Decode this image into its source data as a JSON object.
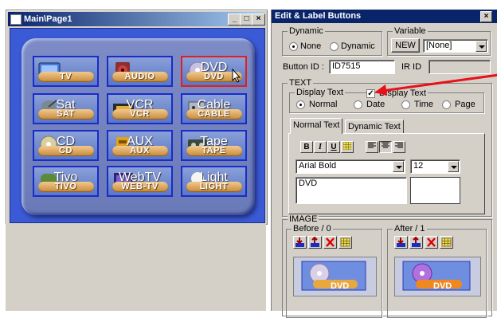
{
  "main_window": {
    "title": "Main\\Page1",
    "controls": {
      "minimize": "_",
      "maximize": "□",
      "close": "×"
    },
    "buttons": [
      {
        "label": "TV",
        "big": "",
        "icon": "tv-icon"
      },
      {
        "label": "AUDIO",
        "big": "",
        "icon": "audio-icon"
      },
      {
        "label": "DVD",
        "big": "DVD",
        "icon": "dvd-icon",
        "selected": true
      },
      {
        "label": "SAT",
        "big": "Sat",
        "icon": "satellite-icon"
      },
      {
        "label": "VCR",
        "big": "VCR",
        "icon": "vcr-icon"
      },
      {
        "label": "CABLE",
        "big": "Cable",
        "icon": "cable-icon"
      },
      {
        "label": "CD",
        "big": "CD",
        "icon": "cd-icon"
      },
      {
        "label": "AUX",
        "big": "AUX",
        "icon": "aux-icon"
      },
      {
        "label": "TAPE",
        "big": "Tape",
        "icon": "tape-icon"
      },
      {
        "label": "TIVO",
        "big": "Tivo",
        "icon": "tivo-icon"
      },
      {
        "label": "WEB-TV",
        "big": "WebTV",
        "icon": "webtv-icon"
      },
      {
        "label": "LIGHT",
        "big": "Light",
        "icon": "light-icon"
      }
    ]
  },
  "dialog": {
    "title": "Edit & Label Buttons",
    "close": "×",
    "dynamic": {
      "label": "Dynamic",
      "none": "None",
      "dynamic": "Dynamic",
      "selected": "None"
    },
    "variable": {
      "label": "Variable",
      "new_button": "NEW",
      "select_value": "[None]"
    },
    "button_id_label": "Button ID :",
    "button_id_value": "ID7515",
    "ir_id_label": "IR ID",
    "ir_id_value": "",
    "text_group": {
      "label": "TEXT",
      "display_text_group": "Display Text",
      "display_text_checkbox": "Display Text",
      "display_text_checked": true,
      "mode_options": [
        "Normal",
        "Date",
        "Time",
        "Page"
      ],
      "selected_mode": "Normal"
    },
    "tabs": [
      "Normal Text",
      "Dynamic Text"
    ],
    "active_tab": "Normal Text",
    "format": {
      "bold": "B",
      "italic": "I",
      "underline": "U"
    },
    "font_value": "Arial Bold",
    "size_value": "12",
    "text_value": "DVD",
    "image_group": {
      "label": "IMAGE",
      "before_label": "Before / 0",
      "after_label": "After / 1",
      "before_caption": "DVD",
      "after_caption": "DVD"
    }
  },
  "colors": {
    "titlebar": "#0a246a",
    "canvas": "#3b5bd6",
    "selected_border": "#e02020",
    "annotation_arrow": "#e8101a"
  }
}
